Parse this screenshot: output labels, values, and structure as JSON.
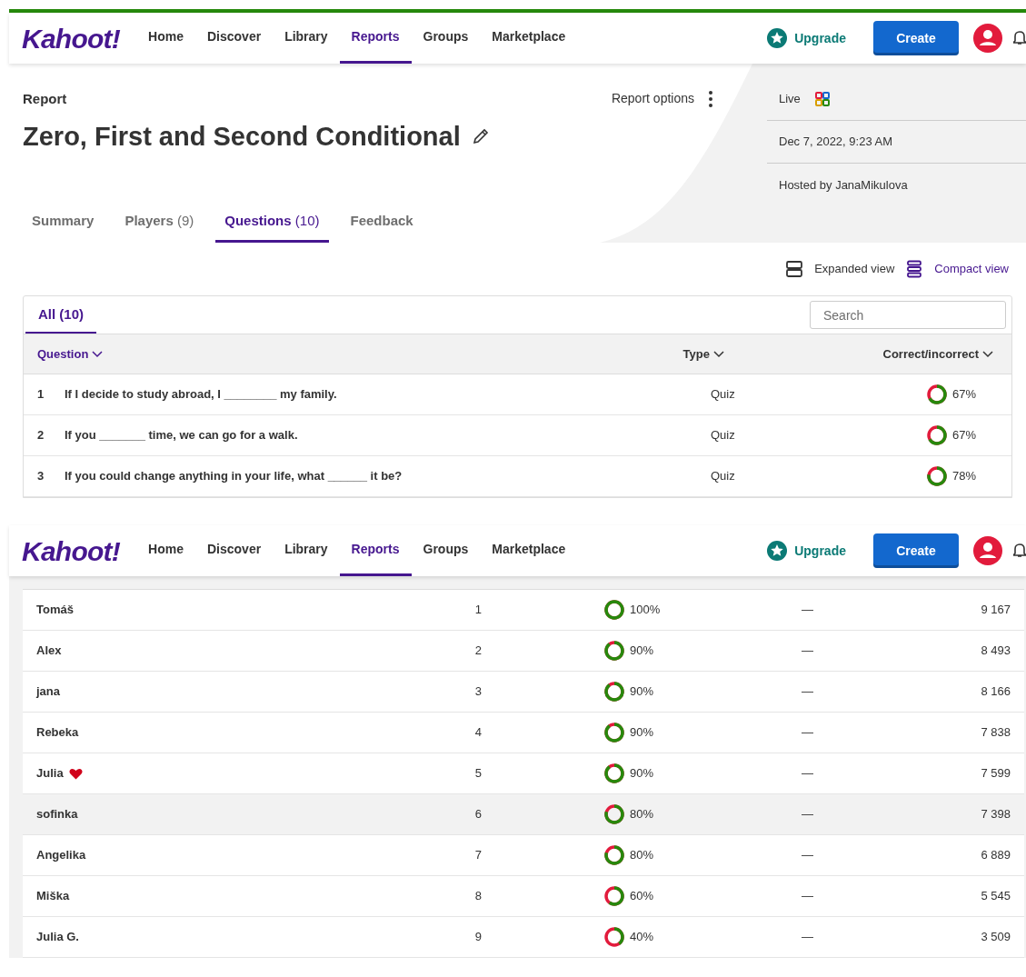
{
  "screens": [
    {
      "nav": {
        "logo": "Kahoot!",
        "items": [
          {
            "label": "Home",
            "selected": false
          },
          {
            "label": "Discover",
            "selected": false
          },
          {
            "label": "Library",
            "selected": false
          },
          {
            "label": "Reports",
            "selected": true
          },
          {
            "label": "Groups",
            "selected": false
          },
          {
            "label": "Marketplace",
            "selected": false
          }
        ],
        "upgrade": "Upgrade",
        "create": "Create"
      },
      "report": {
        "label": "Report",
        "title": "Zero, First and Second Conditional",
        "options": "Report options",
        "info": {
          "mode": "Live",
          "date": "Dec 7, 2022, 9:23 AM",
          "host": "Hosted by JanaMikulova"
        },
        "tabs": [
          {
            "label": "Summary",
            "selected": false
          },
          {
            "label": "Players",
            "count": "(9)",
            "selected": false
          },
          {
            "label": "Questions",
            "count": "(10)",
            "selected": true
          },
          {
            "label": "Feedback",
            "selected": false
          }
        ],
        "views": [
          {
            "label": "Expanded view",
            "selected": false
          },
          {
            "label": "Compact view",
            "selected": true
          }
        ],
        "filter_tab": "All (10)",
        "search": {
          "placeholder": "Search"
        },
        "columns": [
          "Question",
          "Type",
          "Correct/incorrect"
        ],
        "rows": [
          {
            "number": "1",
            "question": "If I decide to study abroad, I ________ my family.",
            "type": "Quiz",
            "level": 0.67,
            "percent": "67%"
          },
          {
            "number": "2",
            "question": "If you _______ time, we can go for a walk.",
            "type": "Quiz",
            "level": 0.67,
            "percent": "67%"
          },
          {
            "number": "3",
            "question": "If you could change anything in your life, what ______ it be?",
            "type": "Quiz",
            "level": 0.78,
            "percent": "78%"
          }
        ]
      }
    },
    {
      "nav": {
        "logo": "Kahoot!",
        "items": [
          {
            "label": "Home",
            "selected": false
          },
          {
            "label": "Discover",
            "selected": false
          },
          {
            "label": "Library",
            "selected": false
          },
          {
            "label": "Reports",
            "selected": true
          },
          {
            "label": "Groups",
            "selected": false
          },
          {
            "label": "Marketplace",
            "selected": false
          }
        ],
        "upgrade": "Upgrade",
        "create": "Create"
      },
      "players": [
        {
          "name": "Tomáš",
          "rank": "1",
          "level": 1.0,
          "percent": "100%",
          "column_4": "—",
          "score": "9 167",
          "heart": false,
          "highlighted": false
        },
        {
          "name": "Alex",
          "rank": "2",
          "level": 0.9,
          "percent": "90%",
          "column_4": "—",
          "score": "8 493",
          "heart": false,
          "highlighted": false
        },
        {
          "name": "jana",
          "rank": "3",
          "level": 0.9,
          "percent": "90%",
          "column_4": "—",
          "score": "8 166",
          "heart": false,
          "highlighted": false
        },
        {
          "name": "Rebeka",
          "rank": "4",
          "level": 0.9,
          "percent": "90%",
          "column_4": "—",
          "score": "7 838",
          "heart": false,
          "highlighted": false
        },
        {
          "name": "Julia",
          "rank": "5",
          "level": 0.9,
          "percent": "90%",
          "column_4": "—",
          "score": "7 599",
          "heart": true,
          "highlighted": false
        },
        {
          "name": "sofinka",
          "rank": "6",
          "level": 0.8,
          "percent": "80%",
          "column_4": "—",
          "score": "7 398",
          "heart": false,
          "highlighted": true
        },
        {
          "name": "Angelika",
          "rank": "7",
          "level": 0.8,
          "percent": "80%",
          "column_4": "—",
          "score": "6 889",
          "heart": false,
          "highlighted": false
        },
        {
          "name": "Miška",
          "rank": "8",
          "level": 0.6,
          "percent": "60%",
          "column_4": "—",
          "score": "5 545",
          "heart": false,
          "highlighted": false
        },
        {
          "name": "Julia G.",
          "rank": "9",
          "level": 0.4,
          "percent": "40%",
          "column_4": "—",
          "score": "3 509",
          "heart": false,
          "highlighted": false
        }
      ]
    }
  ]
}
